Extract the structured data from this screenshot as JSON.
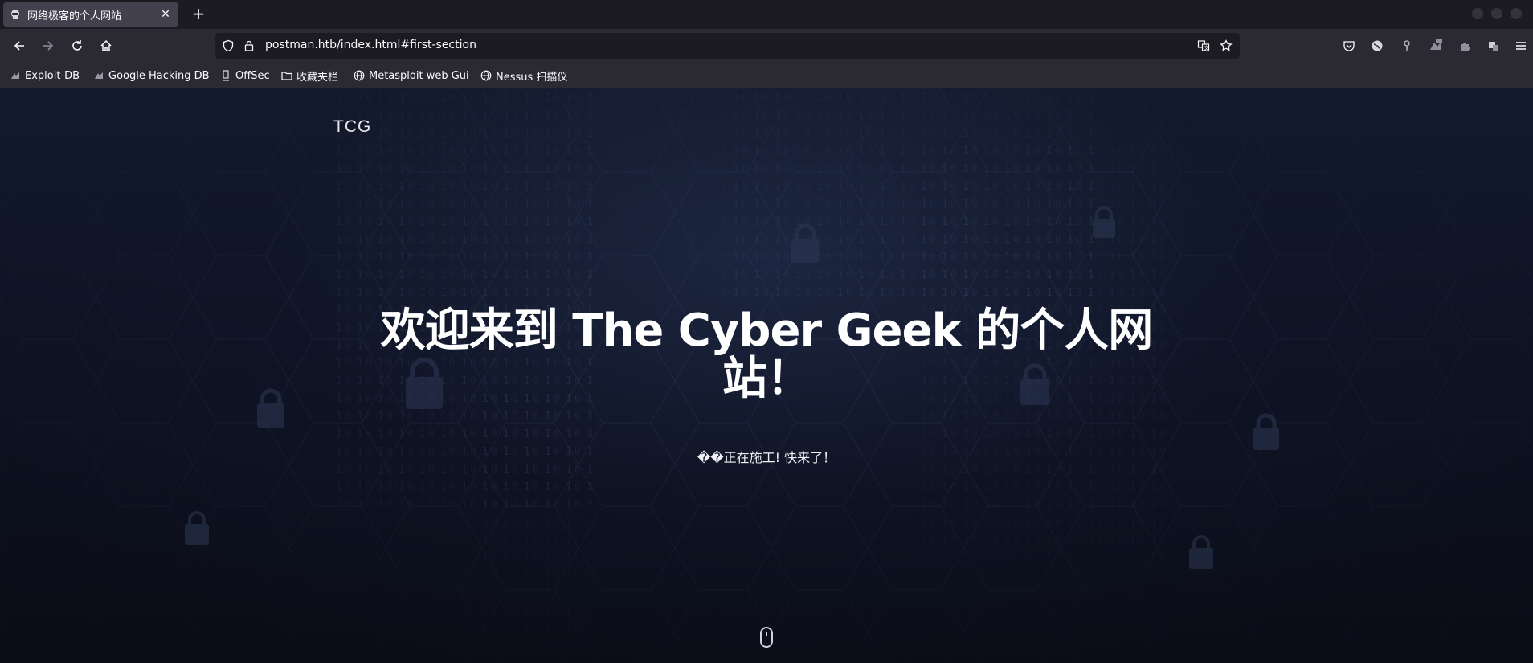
{
  "tabs": [
    {
      "title": "网络极客的个人网站",
      "favicon": "hacker-icon"
    }
  ],
  "new_tab_label": "+",
  "url": "postman.htb/index.html#first-section",
  "bookmarks": [
    {
      "label": "Exploit-DB",
      "icon": "exploit-db-icon"
    },
    {
      "label": "Google Hacking DB",
      "icon": "ghdb-icon"
    },
    {
      "label": "OffSec",
      "icon": "offsec-icon"
    },
    {
      "label": "收藏夹栏",
      "icon": "folder-icon"
    },
    {
      "label": "Metasploit web Gui",
      "icon": "globe-icon"
    },
    {
      "label": "Nessus 扫描仪",
      "icon": "globe-icon"
    }
  ],
  "page": {
    "brand": "TCG",
    "hero_line1": "欢迎来到 The Cyber Geek 的个人网",
    "hero_line2": "站！",
    "subtitle": "��正在施工!  快来了！"
  },
  "colors": {
    "tab_bg": "#42414d",
    "toolbar_bg": "#2b2a33",
    "urlbar_bg": "#1c1b22",
    "page_bg": "#0e1323",
    "text": "#fbfbfe"
  }
}
